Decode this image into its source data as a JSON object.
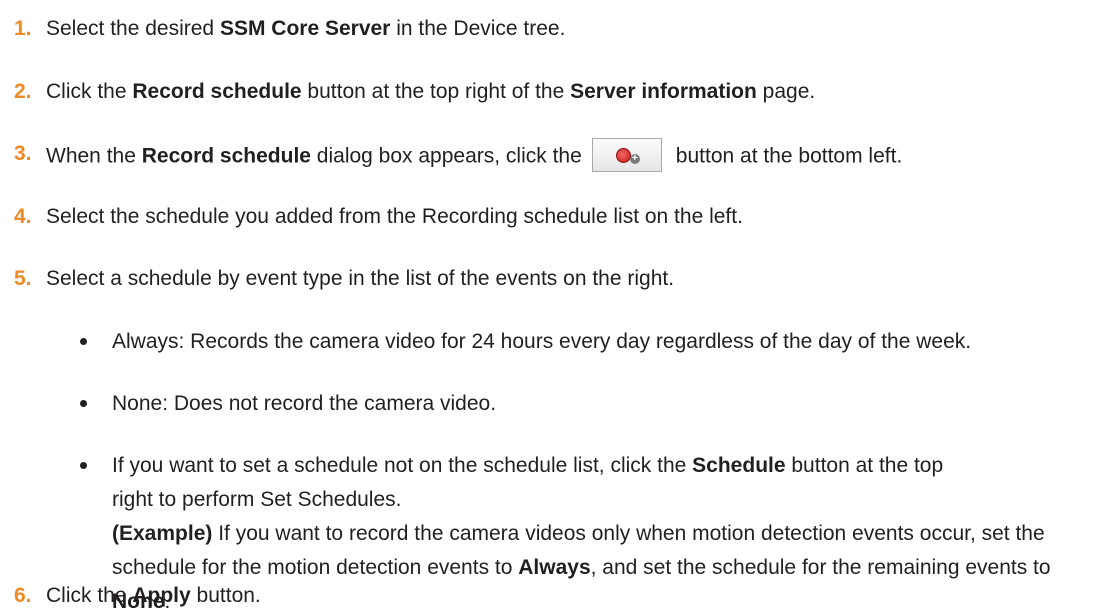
{
  "steps": [
    {
      "num": "1.",
      "parts": [
        "Select the desired ",
        "SSM Core Server",
        " in the Device tree."
      ]
    },
    {
      "num": "2.",
      "parts": [
        "Click the ",
        "Record schedule",
        " button at the top right of the ",
        "Server information",
        " page."
      ]
    },
    {
      "num": "3.",
      "parts": [
        "When the ",
        "Record schedule",
        " dialog box appears, click the",
        "button at the bottom left."
      ]
    },
    {
      "num": "4.",
      "text": "Select the schedule you added from the Recording schedule list on the left."
    },
    {
      "num": "5.",
      "text": "Select a schedule by event type in the list of the events on the right."
    },
    {
      "num": "6.",
      "parts": [
        "Click the ",
        "Apply",
        " button."
      ]
    }
  ],
  "bullets": [
    {
      "text": "Always: Records the camera video for 24 hours every day regardless of the day of the week."
    },
    {
      "text": "None: Does not record the camera video."
    },
    {
      "parts": [
        "If you want to set a schedule not on the schedule list, click the ",
        "Schedule",
        " button at the top",
        "right to perform Set Schedules."
      ]
    }
  ],
  "example": {
    "label": "(Example)",
    "parts": [
      " If you want to record the camera videos only when motion detection events occur, set the schedule for the motion detection events to ",
      "Always",
      ", and set the schedule for the remaining events to ",
      "None",
      "."
    ]
  },
  "icons": {
    "record_add_button": "record-add-icon"
  },
  "colors": {
    "step_number": "#f08a24",
    "text": "#231f20"
  }
}
